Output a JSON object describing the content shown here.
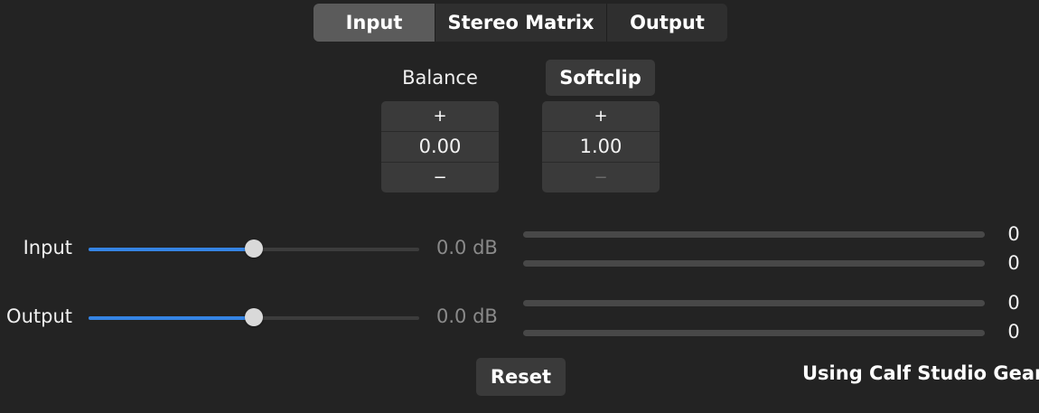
{
  "tabs": [
    {
      "label": "Input",
      "active": true
    },
    {
      "label": "Stereo Matrix",
      "active": false
    },
    {
      "label": "Output",
      "active": false
    }
  ],
  "balance": {
    "label": "Balance",
    "value": "0.00",
    "increment": "+",
    "decrement": "−"
  },
  "softclip": {
    "label": "Softclip",
    "value": "1.00",
    "increment": "+",
    "decrement": "−"
  },
  "input": {
    "label": "Input",
    "db": "0.0 dB",
    "slider_fraction": 0.5,
    "meters": [
      "0",
      "0"
    ]
  },
  "output": {
    "label": "Output",
    "db": "0.0 dB",
    "slider_fraction": 0.5,
    "meters": [
      "0",
      "0"
    ]
  },
  "reset_label": "Reset",
  "footer": "Using Calf Studio Gear",
  "colors": {
    "accent": "#3584e4",
    "background": "#232323",
    "active_tab": "#5b5b5b"
  }
}
